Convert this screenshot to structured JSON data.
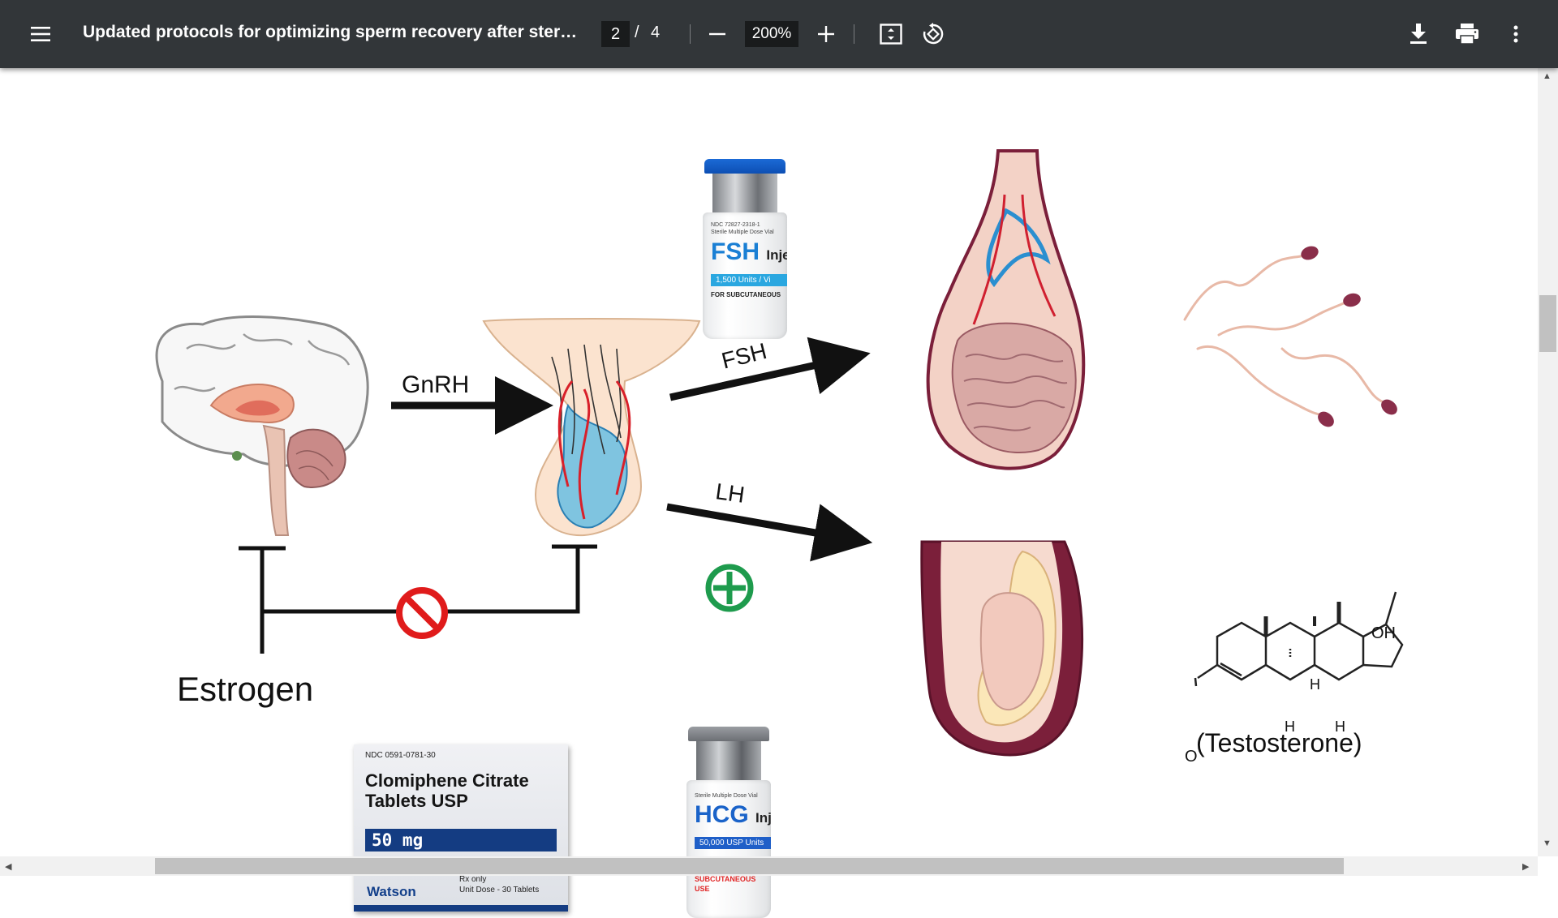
{
  "toolbar": {
    "title": "Updated protocols for optimizing sperm recovery after steroid u...",
    "page_current": "2",
    "page_separator": "/",
    "page_total": "4",
    "zoom": "200%",
    "icons": [
      "menu-icon",
      "minus-icon",
      "plus-icon",
      "fit-page-icon",
      "rotate-icon",
      "download-icon",
      "print-icon",
      "more-vert-icon"
    ]
  },
  "figure": {
    "labels": {
      "gnrh": "GnRH",
      "fsh": "FSH",
      "lh": "LH",
      "estrogen": "Estrogen",
      "testosterone": "(Testosterone)"
    },
    "fsh_vial": {
      "ndc": "NDC 72827-2318-1",
      "dose_type": "Sterile Multiple Dose Vial",
      "name": "FSH",
      "suffix": "Injec",
      "units": "1,500 Units / Vi",
      "route": "FOR SUBCUTANEOUS"
    },
    "hcg_vial": {
      "dose_type": "Sterile Multiple Dose Vial",
      "name": "HCG",
      "suffix": "Inject",
      "units": "50,000 USP Units",
      "route": "FOR INTRAMUSCULAR\nSUBCUTANEOUS USE"
    },
    "clomiphene": {
      "ndc": "NDC 0591-0781-30",
      "name": "Clomiphene Citrate\nTablets USP",
      "dose": "50 mg",
      "brand": "Watson",
      "rx": "Rx only\nUnit Dose - 30 Tablets"
    },
    "molecule_labels": {
      "oh": "OH",
      "o": "O",
      "h": "H"
    },
    "colors": {
      "plus_green": "#1e9b4d",
      "prohibit_red": "#e01b1b",
      "arrow": "#111111"
    }
  }
}
